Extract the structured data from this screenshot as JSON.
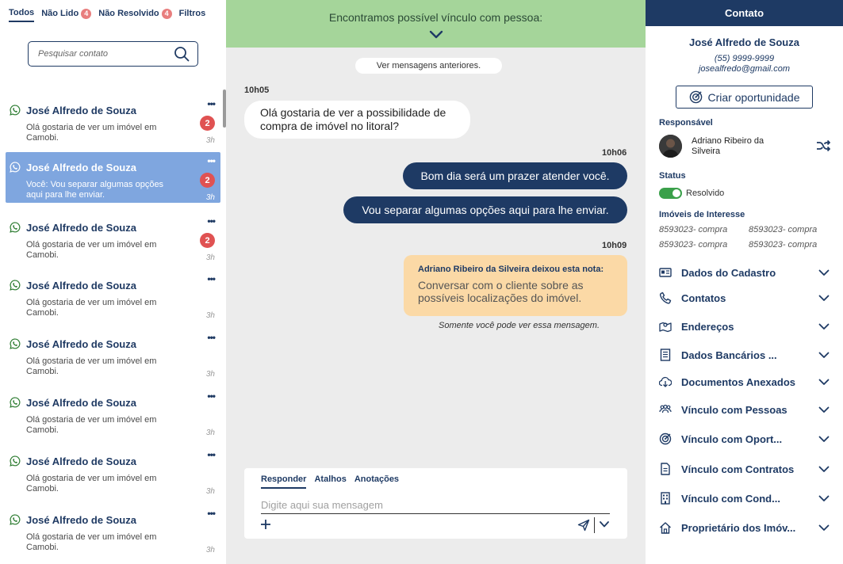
{
  "filters": {
    "todos": "Todos",
    "nao_lido": "Não Lido",
    "nao_lido_count": "4",
    "nao_resolvido": "Não Resolvido",
    "nao_resolvido_count": "4",
    "filtros": "Filtros"
  },
  "search": {
    "placeholder": "Pesquisar contato"
  },
  "conversations": [
    {
      "name": "José Alfredo de Souza",
      "preview": "Olá gostaria de ver um imóvel em Camobi.",
      "count": "2",
      "time": "3h"
    },
    {
      "name": "José Alfredo de Souza",
      "preview": "Você: Vou separar algumas opções aqui para lhe enviar.",
      "count": "2",
      "time": "3h"
    },
    {
      "name": "José Alfredo de Souza",
      "preview": "Olá gostaria de ver um imóvel em Camobi.",
      "count": "2",
      "time": "3h"
    },
    {
      "name": "José Alfredo de Souza",
      "preview": "Olá gostaria de ver um imóvel em Camobi.",
      "count": "",
      "time": "3h"
    },
    {
      "name": "José Alfredo de Souza",
      "preview": "Olá gostaria de ver um imóvel em Camobi.",
      "count": "",
      "time": "3h"
    },
    {
      "name": "José Alfredo de Souza",
      "preview": "Olá gostaria de ver um imóvel em Camobi.",
      "count": "",
      "time": "3h"
    },
    {
      "name": "José Alfredo de Souza",
      "preview": "Olá gostaria de ver um imóvel em Camobi.",
      "count": "",
      "time": "3h"
    },
    {
      "name": "José Alfredo de Souza",
      "preview": "Olá gostaria de ver um imóvel em Camobi.",
      "count": "",
      "time": "3h"
    }
  ],
  "chat": {
    "banner": "Encontramos possível vínculo com pessoa:",
    "load_previous": "Ver mensagens anteriores.",
    "time1": "10h05",
    "msg_in_1": "Olá gostaria de ver a possibilidade de compra de imóvel no litoral?",
    "time2": "10h06",
    "msg_out_1": "Bom dia será um prazer atender você.",
    "msg_out_2": "Vou separar algumas opções aqui para lhe enviar.",
    "time3": "10h09",
    "note_author": "Adriano Ribeiro da Silveira deixou esta nota:",
    "note_body": "Conversar com o cliente sobre as possíveis localizações do imóvel.",
    "note_hint": "Somente você pode ver essa mensagem."
  },
  "composer": {
    "tab_reply": "Responder",
    "tab_shortcuts": "Atalhos",
    "tab_notes": "Anotações",
    "placeholder": "Digite aqui sua mensagem"
  },
  "contact": {
    "header": "Contato",
    "name": "José Alfredo de Souza",
    "phone": "(55) 9999-9999",
    "email": "josealfredo@gmail.com",
    "create_opportunity": "Criar oportunidade",
    "responsible_title": "Responsável",
    "responsible_name": "Adriano Ribeiro da Silveira",
    "status_title": "Status",
    "status_value": "Resolvido",
    "properties_title": "Imóveis de Interesse",
    "properties": [
      "8593023- compra",
      "8593023- compra",
      "8593023- compra",
      "8593023- compra"
    ],
    "sections": [
      {
        "label": "Dados do Cadastro",
        "icon": "id-card-icon"
      },
      {
        "label": "Contatos",
        "icon": "phone-icon"
      },
      {
        "label": "Endereços",
        "icon": "map-icon"
      },
      {
        "label": "Dados Bancários ...",
        "icon": "bank-document-icon"
      },
      {
        "label": "Documentos Anexados",
        "icon": "cloud-download-icon"
      },
      {
        "label": "Vínculo com Pessoas",
        "icon": "people-icon"
      },
      {
        "label": "Vínculo com Oport...",
        "icon": "target-icon"
      },
      {
        "label": "Vínculo com Contratos",
        "icon": "contract-icon"
      },
      {
        "label": "Vínculo com Cond...",
        "icon": "building-icon"
      },
      {
        "label": "Proprietário dos Imóv...",
        "icon": "house-icon"
      }
    ]
  },
  "colors": {
    "primary": "#1e3a64",
    "selected_row": "#7fa6df",
    "banner": "#a5d59a",
    "note": "#fbd9a6",
    "badge": "#e05252",
    "whatsapp": "#2e7d32",
    "toggle_on": "#3aa04a"
  }
}
